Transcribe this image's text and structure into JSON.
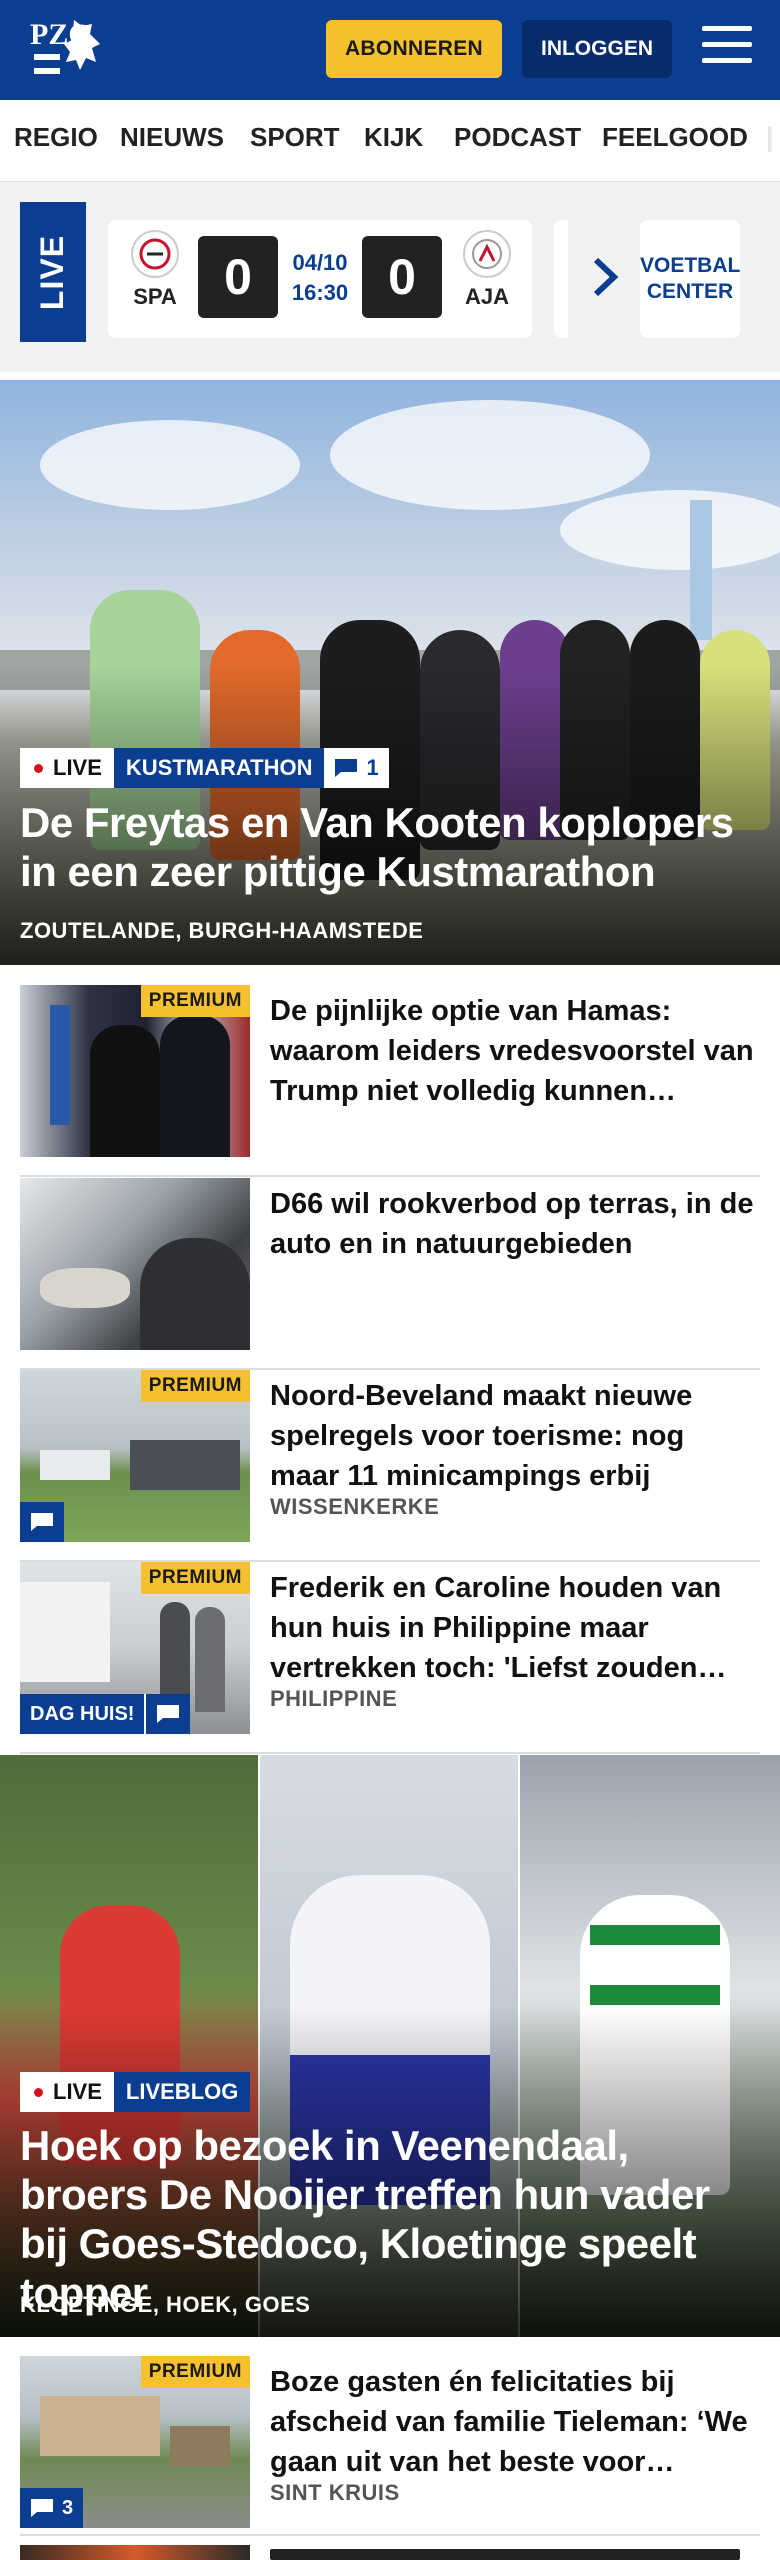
{
  "header": {
    "logo_text": "PZC",
    "subscribe_label": "ABONNEREN",
    "login_label": "INLOGGEN"
  },
  "nav": {
    "items": [
      "REGIO",
      "NIEUWS",
      "SPORT",
      "KIJK",
      "PODCAST",
      "FEELGOOD"
    ]
  },
  "live_scores": {
    "tag": "LIVE",
    "match": {
      "home": "SPA",
      "away": "AJA",
      "home_score": "0",
      "away_score": "0",
      "date": "04/10",
      "time": "16:30"
    },
    "voetbal_center_label": "VOETBAL CENTER"
  },
  "hero": {
    "live_label": "LIVE",
    "category": "KUSTMARATHON",
    "comment_count": "1",
    "title": "De Freytas en Van Kooten koplopers in een zeer pittige Kustmarathon",
    "location": "ZOUTELANDE, BURGH-HAAMSTEDE"
  },
  "articles": [
    {
      "premium_label": "PREMIUM",
      "title": "De pijnlijke optie van Hamas: waarom leiders vredesvoorstel van Trump niet volledig kunnen…",
      "location": ""
    },
    {
      "premium_label": "",
      "title": "D66 wil rookverbod op terras, in de auto en in natuurgebieden",
      "location": ""
    },
    {
      "premium_label": "PREMIUM",
      "title": "Noord-Beveland maakt nieuwe spelregels voor toerisme: nog maar 11 minicampings erbij",
      "location": "WISSENKERKE"
    },
    {
      "premium_label": "PREMIUM",
      "title": "Frederik en Caroline houden van hun huis in Philippine maar vertrekken toch: 'Liefst zouden…",
      "location": "PHILIPPINE",
      "tag": "DAG HUIS!"
    }
  ],
  "feature2": {
    "live_label": "LIVE",
    "category": "LIVEBLOG",
    "title": "Hoek op bezoek in Veenendaal, broers De Nooijer treffen hun vader bij Goes-Stedoco, Kloetinge speelt topper",
    "location": "KLOETINGE, HOEK, GOES"
  },
  "article5": {
    "premium_label": "PREMIUM",
    "title": "Boze gasten én felicitaties bij afscheid van familie Tieleman: ‘We gaan uit van het beste voor…",
    "location": "SINT KRUIS",
    "comment_count": "3"
  },
  "colors": {
    "brand_blue": "#0b3d91",
    "accent_yellow": "#f6c12c",
    "live_red": "#d3121c"
  }
}
